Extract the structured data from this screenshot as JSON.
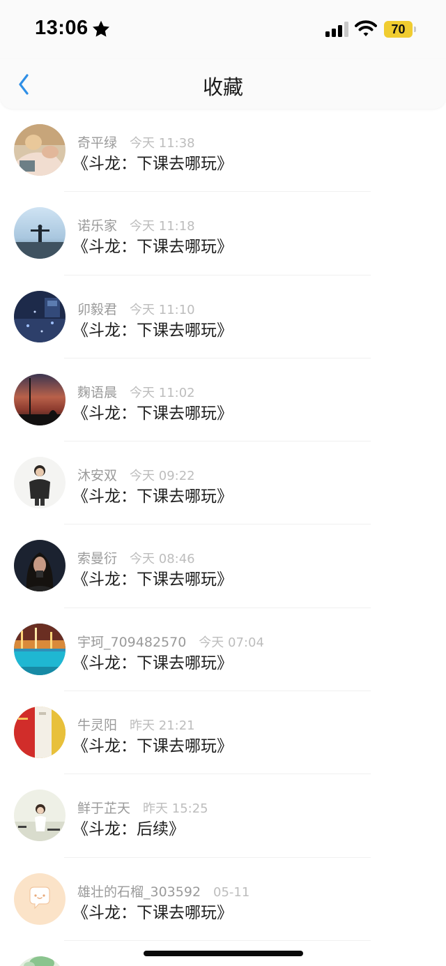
{
  "status_bar": {
    "time": "13:06",
    "battery_level": "70",
    "icons": [
      "star-icon",
      "signal-icon",
      "wifi-icon",
      "battery-icon"
    ],
    "battery_color": "#f0cc30"
  },
  "nav": {
    "title": "收藏",
    "back_icon": "chevron-left-icon",
    "accent_color": "#2f8fe6"
  },
  "favorites": [
    {
      "author": "奇平绿",
      "time": "今天 11:38",
      "title": "《斗龙：下课去哪玩》"
    },
    {
      "author": "诺乐家",
      "time": "今天 11:18",
      "title": "《斗龙：下课去哪玩》"
    },
    {
      "author": "卯毅君",
      "time": "今天 11:10",
      "title": "《斗龙：下课去哪玩》"
    },
    {
      "author": "麴语晨",
      "time": "今天 11:02",
      "title": "《斗龙：下课去哪玩》"
    },
    {
      "author": "沐安双",
      "time": "今天 09:22",
      "title": "《斗龙：下课去哪玩》"
    },
    {
      "author": "索曼衍",
      "time": "今天 08:46",
      "title": "《斗龙：下课去哪玩》"
    },
    {
      "author": "宇珂_709482570",
      "time": "今天 07:04",
      "title": "《斗龙：下课去哪玩》"
    },
    {
      "author": "牛灵阳",
      "time": "昨天 21:21",
      "title": "《斗龙：下课去哪玩》"
    },
    {
      "author": "鲜于芷天",
      "time": "昨天 15:25",
      "title": "《斗龙：后续》"
    },
    {
      "author": "雄壮的石榴_303592",
      "time": "05-11",
      "title": "《斗龙：下课去哪玩》"
    }
  ]
}
